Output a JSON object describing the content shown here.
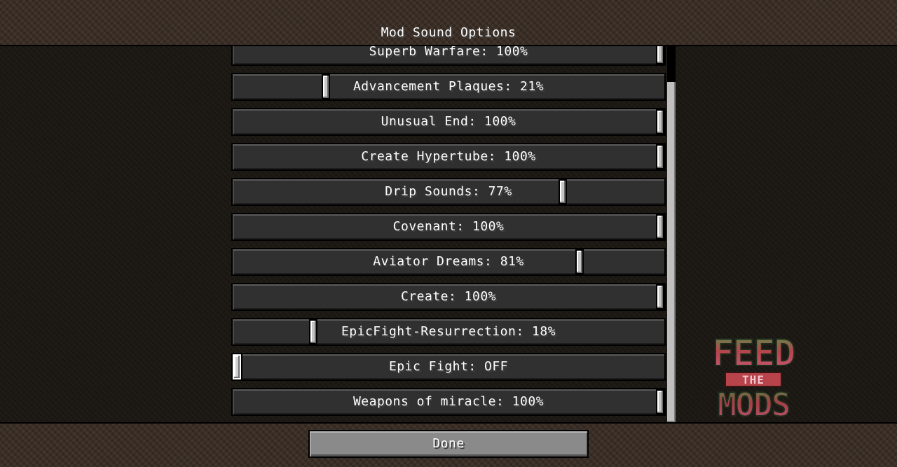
{
  "screen": {
    "title": "Mod Sound Options"
  },
  "sliders": [
    {
      "label": "Superb Warfare: 100%",
      "value": 1.0
    },
    {
      "label": "Advancement Plaques: 21%",
      "value": 0.21
    },
    {
      "label": "Unusual End: 100%",
      "value": 1.0
    },
    {
      "label": "Create Hypertube: 100%",
      "value": 1.0
    },
    {
      "label": "Drip Sounds: 77%",
      "value": 0.77
    },
    {
      "label": "Covenant: 100%",
      "value": 1.0
    },
    {
      "label": "Aviator Dreams: 81%",
      "value": 0.81
    },
    {
      "label": "Create: 100%",
      "value": 1.0
    },
    {
      "label": "EpicFight-Resurrection: 18%",
      "value": 0.18
    },
    {
      "label": "Epic Fight: OFF",
      "value": 0.0
    },
    {
      "label": "Weapons of miracle: 100%",
      "value": 1.0
    }
  ],
  "footer": {
    "done_label": "Done"
  },
  "logo": {
    "top_text": "FEED",
    "middle_text": "THE",
    "bottom_text": "MODS",
    "colors": {
      "green": "#3d8b3d",
      "red": "#c0392b",
      "pink": "#d2698c",
      "dark": "#1e3b1e"
    }
  },
  "colors": {
    "slider_bg": "#303030",
    "knob": "#c6c6c6",
    "button": "#8a8a8a",
    "text": "#ffffff",
    "dirt": "#3b2f26"
  }
}
